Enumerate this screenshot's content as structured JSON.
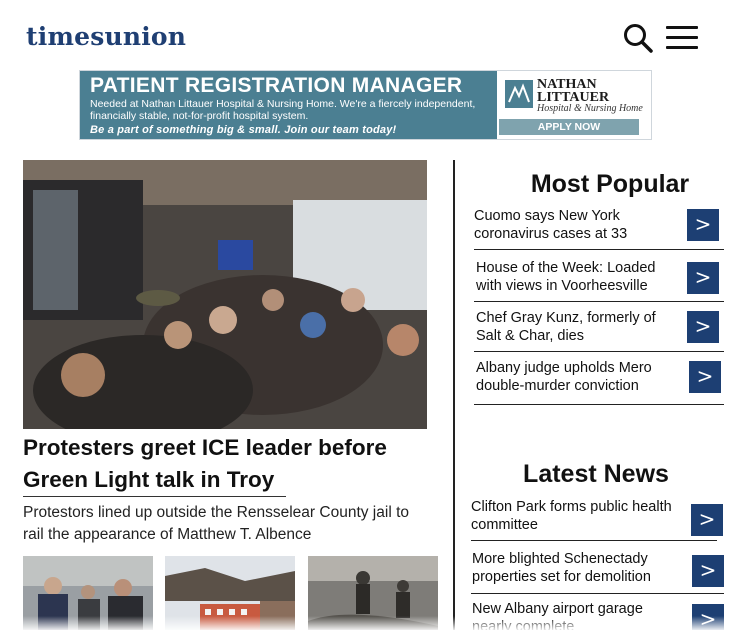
{
  "header": {
    "logo": "timesunion",
    "search_icon": "search-icon",
    "menu_icon": "hamburger-menu-icon"
  },
  "ad": {
    "title": "PATIENT REGISTRATION MANAGER",
    "body": "Needed at Nathan Littauer Hospital & Nursing Home. We're a fiercely independent, financially stable, not-for-profit hospital system.",
    "tagline": "Be a part of something big & small. Join our team today!",
    "org_line1": "NATHAN",
    "org_line2": "LITTAUER",
    "org_sub": "Hospital & Nursing Home",
    "cta": "APPLY NOW",
    "colors": {
      "panel": "#4b7f92",
      "button": "#7fa3ae"
    }
  },
  "lead_story": {
    "headline": "Protesters greet ICE leader before Green Light talk in Troy",
    "dek": "Protestors lined up outside the Rensselear County jail to rail the appearance of Matthew T. Albence"
  },
  "most_popular": {
    "title": "Most Popular",
    "items": [
      {
        "text": "Cuomo says New York coronavirus cases at 33"
      },
      {
        "text": "House of the Week: Loaded with views in Voorheesville"
      },
      {
        "text": "Chef Gray Kunz, formerly of Salt & Char, dies"
      },
      {
        "text": "Albany judge upholds Mero double-murder conviction"
      }
    ]
  },
  "latest_news": {
    "title": "Latest News",
    "items": [
      {
        "text": "Clifton Park forms public health committee"
      },
      {
        "text": "More blighted Schenectady properties set for demolition"
      },
      {
        "text": "New Albany airport garage nearly complete"
      }
    ]
  },
  "arrow_glyph": ">",
  "colors": {
    "brand": "#1f3f73",
    "arrow_button": "#1d3f73"
  }
}
